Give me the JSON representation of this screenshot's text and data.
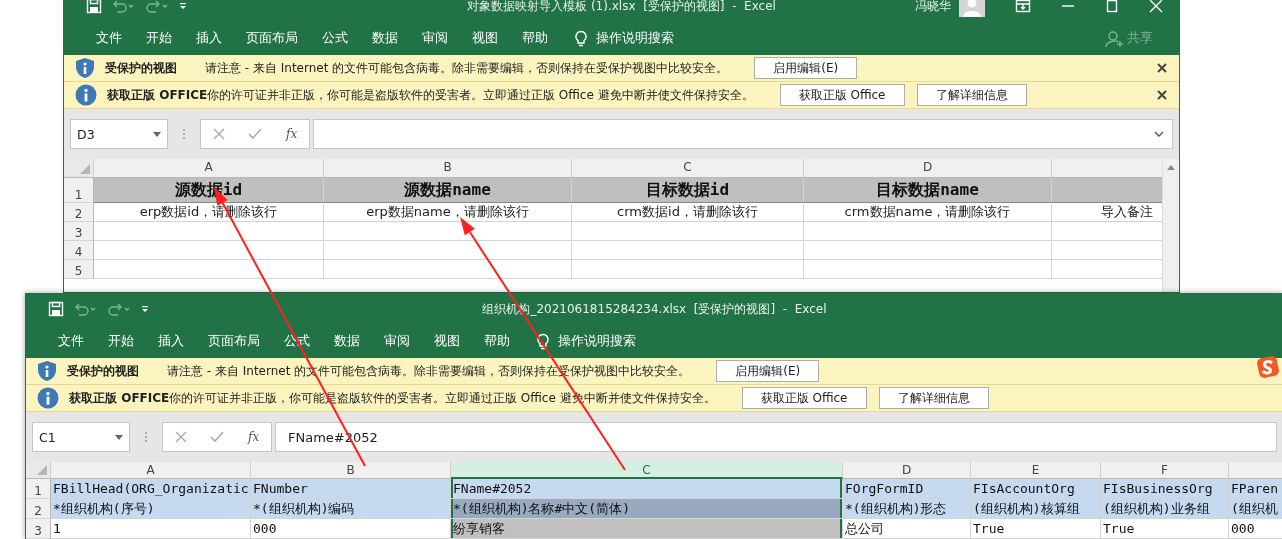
{
  "windows": [
    {
      "kind": "template",
      "title": "对象数据映射导入模板 (1).xlsx  [受保护的视图]  -  Excel",
      "user": "冯晓华",
      "tabs": [
        "文件",
        "开始",
        "插入",
        "页面布局",
        "公式",
        "数据",
        "审阅",
        "视图",
        "帮助"
      ],
      "search": "操作说明搜索",
      "share": "共享",
      "info_bars": [
        {
          "kind": "shield",
          "title": "受保护的视图",
          "message": "请注意 - 来自 Internet 的文件可能包含病毒。除非需要编辑，否则保持在受保护视图中比较安全。",
          "buttons": [
            "启用编辑(E)"
          ],
          "closable": true
        },
        {
          "kind": "info",
          "title": "获取正版 OFFICE",
          "message": "你的许可证并非正版，你可能是盗版软件的受害者。立即通过正版 Office 避免中断并使文件保持安全。",
          "buttons": [
            "获取正版 Office",
            "了解详细信息"
          ],
          "closable": true
        }
      ],
      "name_box": "D3",
      "function_label": "fx",
      "columns": [
        {
          "label": "A",
          "selected": false
        },
        {
          "label": "B",
          "selected": false
        },
        {
          "label": "C",
          "selected": false
        },
        {
          "label": "D",
          "selected": false
        },
        {
          "selected": false
        }
      ],
      "rows": [
        {
          "number": "1",
          "kind": "heading",
          "cells": [
            {
              "text": "源数据id",
              "color": "#bfbfbf"
            },
            {
              "text": "源数据name",
              "color": "#bfbfbf"
            },
            {
              "text": "目标数据id",
              "color": "#bfbfbf"
            },
            {
              "text": "目标数据name",
              "color": "#bfbfbf"
            },
            {
              "color": "#bfbfbf"
            }
          ]
        },
        {
          "number": "2",
          "kind": "plain",
          "cells": [
            {
              "text": "erp数据id，请删除该行"
            },
            {
              "text": "erp数据name，请删除该行"
            },
            {
              "text": "crm数据id，请删除该行"
            },
            {
              "text": "crm数据name，请删除该行"
            },
            {
              "text": "导入备注"
            }
          ]
        },
        {
          "number": "3",
          "kind": "plain",
          "cells": []
        },
        {
          "number": "4",
          "kind": "plain",
          "cells": []
        },
        {
          "number": "5",
          "kind": "plain",
          "cells": []
        }
      ]
    },
    {
      "kind": "export",
      "title": "组织机构_2021061815284234.xlsx  [受保护的视图]  -  Excel",
      "tabs": [
        "文件",
        "开始",
        "插入",
        "页面布局",
        "公式",
        "数据",
        "审阅",
        "视图",
        "帮助"
      ],
      "search": "操作说明搜索",
      "info_bars": [
        {
          "kind": "shield",
          "title": "受保护的视图",
          "message": "请注意 - 来自 Internet 的文件可能包含病毒。除非需要编辑，否则保持在受保护视图中比较安全。",
          "buttons": [
            "启用编辑(E)"
          ],
          "closable": false
        },
        {
          "kind": "info",
          "title": "获取正版 OFFICE",
          "message": "你的许可证并非正版，你可能是盗版软件的受害者。立即通过正版 Office 避免中断并使文件保持安全。",
          "buttons": [
            "获取正版 Office",
            "了解详细信息"
          ],
          "closable": false
        }
      ],
      "name_box": "C1",
      "function_label": "fx",
      "formula": "FName#2052",
      "columns": [
        {
          "label": "A",
          "selected": false
        },
        {
          "label": "B",
          "selected": false
        },
        {
          "label": "C",
          "selected": true
        },
        {
          "label": "D",
          "selected": false
        },
        {
          "label": "E",
          "selected": false
        },
        {
          "label": "F",
          "selected": false
        },
        {
          "selected": false
        }
      ],
      "rows": [
        {
          "number": "1",
          "kind": "plain",
          "cells": [
            {
              "text": "FBillHead(ORG_Organizatic",
              "color": "#c5d9f1"
            },
            {
              "text": "FNumber",
              "color": "#c5d9f1"
            },
            {
              "text": "FName#2052",
              "color": "#c5d9f1"
            },
            {
              "text": "FOrgFormID",
              "color": "#c5d9f1"
            },
            {
              "text": "FIsAccountOrg",
              "color": "#c5d9f1"
            },
            {
              "text": "FIsBusinessOrg",
              "color": "#c5d9f1"
            },
            {
              "text": "FParen",
              "color": "#c5d9f1"
            }
          ]
        },
        {
          "number": "2",
          "kind": "plain",
          "cells": [
            {
              "text": "*组织机构(序号)",
              "color": "#c5d9f1"
            },
            {
              "text": "*(组织机构)编码",
              "color": "#c5d9f1"
            },
            {
              "text": "*(组织机构)名称#中文(简体)",
              "color": "#98a9c0"
            },
            {
              "text": "*(组织机构)形态",
              "color": "#c5d9f1"
            },
            {
              "text": "(组织机构)核算组",
              "color": "#c5d9f1"
            },
            {
              "text": "(组织机构)业务组",
              "color": "#c5d9f1"
            },
            {
              "text": "(组织机",
              "color": "#c5d9f1"
            }
          ]
        },
        {
          "number": "3",
          "kind": "plain",
          "cells": [
            {
              "text": "1"
            },
            {
              "text": "000"
            },
            {
              "text": "纷享销客",
              "color": "#c0c0c0"
            },
            {
              "text": "总公司"
            },
            {
              "text": "True"
            },
            {
              "text": "True"
            },
            {
              "text": "000"
            }
          ]
        }
      ]
    }
  ]
}
